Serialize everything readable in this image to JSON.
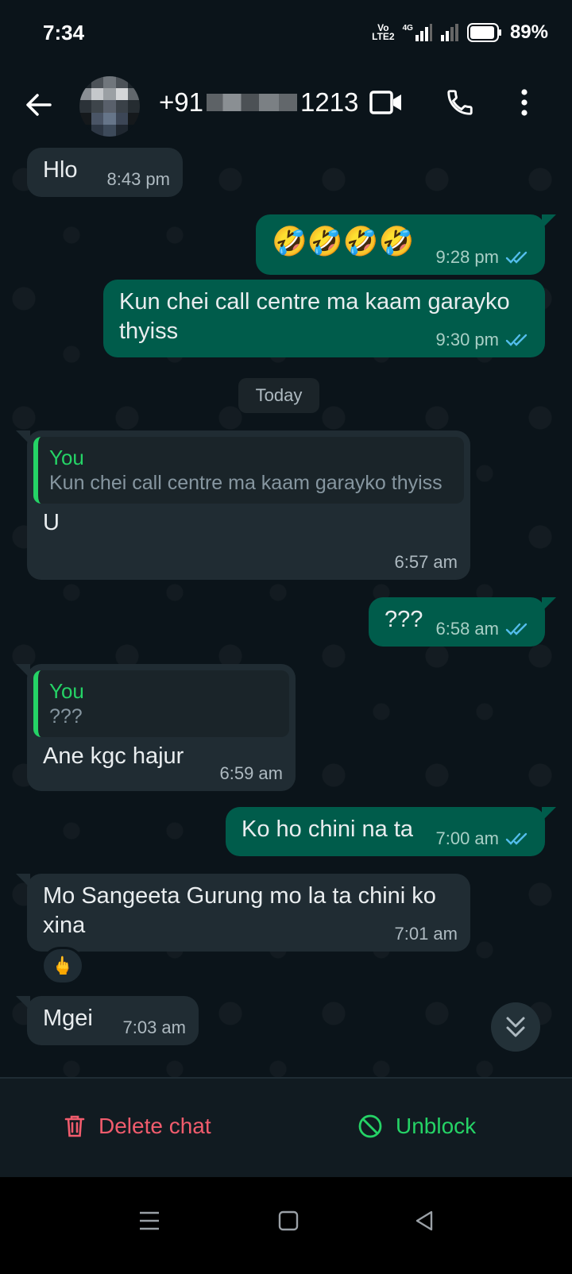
{
  "status_bar": {
    "time": "7:34",
    "volte_top": "Vo",
    "volte_bottom": "LTE2",
    "network": "4G",
    "battery": "89%"
  },
  "header": {
    "contact_prefix": "+91",
    "contact_suffix": "1213"
  },
  "day_divider": "Today",
  "messages": [
    {
      "direction": "in",
      "text": "Hlo",
      "time": "8:43 pm"
    },
    {
      "direction": "out",
      "text": "🤣🤣🤣🤣",
      "time": "9:28 pm",
      "read": true
    },
    {
      "direction": "out",
      "text": "Kun chei call centre ma kaam garayko thyiss",
      "time": "9:30 pm",
      "read": true
    },
    {
      "direction": "in",
      "quote_author": "You",
      "quote_text": "Kun chei call centre ma kaam garayko thyiss",
      "text": "U",
      "time": "6:57 am"
    },
    {
      "direction": "out",
      "text": "???",
      "time": "6:58 am",
      "read": true
    },
    {
      "direction": "in",
      "quote_author": "You",
      "quote_text": "???",
      "text": "Ane kgc hajur",
      "time": "6:59 am"
    },
    {
      "direction": "out",
      "text": "Ko ho chini na ta",
      "time": "7:00 am",
      "read": true
    },
    {
      "direction": "in",
      "text": "Mo Sangeeta Gurung  mo la ta chini ko xina",
      "time": "7:01 am",
      "reaction": "🖕"
    },
    {
      "direction": "in",
      "text": "Mgei",
      "time": "7:03 am"
    }
  ],
  "action_bar": {
    "delete_label": "Delete chat",
    "unblock_label": "Unblock"
  },
  "colors": {
    "incoming": "#202c33",
    "outgoing": "#005c4b",
    "accent_green": "#25d366",
    "danger": "#f15c6d",
    "read_tick": "#53bdeb"
  }
}
